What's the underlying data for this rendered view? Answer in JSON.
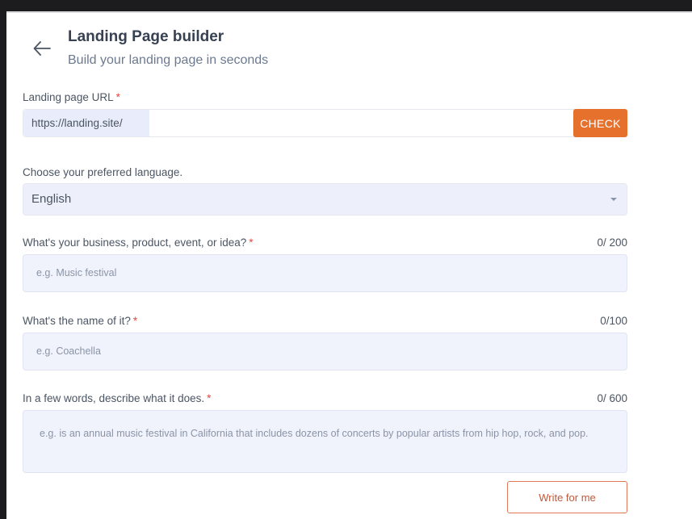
{
  "header": {
    "title": "Landing Page builder",
    "subtitle": "Build your landing page in seconds"
  },
  "url": {
    "label": "Landing page URL",
    "required_mark": "*",
    "prefix": "https://landing.site/",
    "value": "",
    "check_label": "CHECK"
  },
  "language": {
    "label": "Choose your preferred language.",
    "selected": "English"
  },
  "business": {
    "label": "What's your business, product, event, or idea?",
    "required_mark": "*",
    "counter": "0/ 200",
    "placeholder": "e.g. Music festival"
  },
  "name": {
    "label": "What's the name of it?",
    "required_mark": "*",
    "counter": "0/100",
    "placeholder": "e.g. Coachella"
  },
  "description": {
    "label": "In a few words, describe what it does.",
    "required_mark": "*",
    "counter": "0/ 600",
    "placeholder": "e.g. is an annual music festival in California that includes dozens of concerts by popular artists from hip hop, rock, and pop."
  },
  "actions": {
    "write_label": "Write for me"
  },
  "colors": {
    "accent": "#e5712c",
    "required": "#e5483f",
    "field_bg": "#f1f3fc"
  }
}
